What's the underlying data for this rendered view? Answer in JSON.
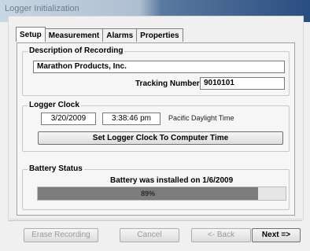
{
  "window": {
    "title": "Logger Initialization"
  },
  "tabs": [
    {
      "label": "Setup"
    },
    {
      "label": "Measurement"
    },
    {
      "label": "Alarms"
    },
    {
      "label": "Properties"
    }
  ],
  "description": {
    "group_label": "Description of Recording",
    "value": "Marathon Products, Inc.",
    "tracking_label": "Tracking Number:",
    "tracking_value": "9010101"
  },
  "clock": {
    "group_label": "Logger Clock",
    "date": "3/20/2009",
    "time": "3:38:46 pm",
    "timezone": "Pacific Daylight Time",
    "set_button": "Set Logger Clock To Computer Time"
  },
  "battery": {
    "group_label": "Battery Status",
    "installed_text": "Battery was installed on 1/6/2009",
    "level_text": "89%",
    "level_fraction": 0.89
  },
  "buttons": {
    "erase": "Erase Recording",
    "cancel": "Cancel",
    "back": "<- Back",
    "next": "Next =>"
  }
}
